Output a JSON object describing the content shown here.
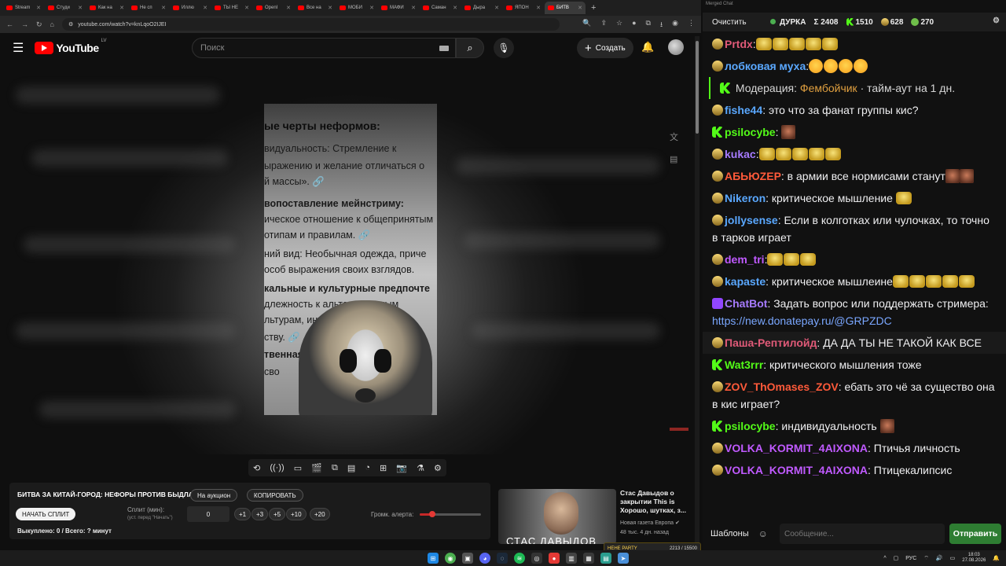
{
  "browser": {
    "tabs": [
      {
        "label": "Stream",
        "active": false
      },
      {
        "label": "Студи",
        "active": false
      },
      {
        "label": "Как на",
        "active": false
      },
      {
        "label": "Не сп",
        "active": false
      },
      {
        "label": "Иллю",
        "active": false
      },
      {
        "label": "ТЫ НЕ",
        "active": false
      },
      {
        "label": "OpenI",
        "active": false
      },
      {
        "label": "Все на",
        "active": false
      },
      {
        "label": "МОБИ",
        "active": false
      },
      {
        "label": "МАФИ",
        "active": false
      },
      {
        "label": "Саман",
        "active": false
      },
      {
        "label": "Дыра",
        "active": false
      },
      {
        "label": "ЯПОН",
        "active": false
      },
      {
        "label": "БИТВ",
        "active": true
      }
    ],
    "url": "youtube.com/watch?v=knLqoO2IJEI"
  },
  "youtube": {
    "logo_text": "YouTube",
    "country": "LV",
    "search_placeholder": "Поиск",
    "create_label": "Создать"
  },
  "video": {
    "card_lines": [
      {
        "text": "ые черты неформов:",
        "style": "h"
      },
      {
        "text": "видуальность: Стремление к",
        "bold_prefix": "видуальность:"
      },
      {
        "text": "ыражению и желание отличаться о"
      },
      {
        "text": "й массы». 🔗"
      },
      {
        "text": "вопоставление мейнстриму:",
        "style": "b"
      },
      {
        "text": "ическое отношение к общепринятым"
      },
      {
        "text": "отипам и правилам. 🔗"
      },
      {
        "text": "ний вид: Необычная одежда, приче",
        "bold_prefix": "ний вид:"
      },
      {
        "text": "особ выражения своих взглядов."
      },
      {
        "text": "кальные и культурные предпочте",
        "style": "b"
      },
      {
        "text": "длежность к альтернативным"
      },
      {
        "text": "льтурам, инте               и"
      },
      {
        "text": "ству. 🔗"
      },
      {
        "text": "твенная",
        "style": "b"
      },
      {
        "text": "сво"
      }
    ]
  },
  "toolbar_icons": [
    "loop-icon",
    "broadcast-icon",
    "screen-icon",
    "clapper-icon",
    "pip-icon",
    "subtitles-icon",
    "speed-icon",
    "add-icon",
    "camera-icon",
    "flask-icon",
    "settings-icon"
  ],
  "panel": {
    "title": "БИТВА ЗА КИТАЙ-ГОРОД: НЕФОРЫ ПРОТИВ БЫДЛА",
    "auction_btn": "На аукцион",
    "copy_btn": "КОПИРОВАТЬ",
    "start_btn": "НАЧАТЬ СПЛИТ",
    "split_label": "Сплит (мин):",
    "split_hint": "(уст. перед \"Начать\")",
    "split_value": "0",
    "increments": [
      "+1",
      "+3",
      "+5",
      "+10",
      "+20"
    ],
    "volume_label": "Громк. алерта:",
    "volume_fraction": 0.21,
    "bought": "Выкуплено: 0 / Всего: ? минут"
  },
  "recommendation": {
    "title": "Стас Давыдов о закрытии This is Хорошо, шутках, з...",
    "channel": "Новая газета Европа",
    "meta": "48 тыс.  4 дн. назад",
    "thumb_caption": "СТАС ДАВЫДОВ"
  },
  "chat": {
    "window_title": "Merged Chat",
    "clear_label": "Очистить",
    "channel": "ДУРКА",
    "stat_total": "Σ 2408",
    "stat_kick": "1510",
    "stat_twitch": "628",
    "stat_vk": "270",
    "templates_label": "Шаблоны",
    "input_placeholder": "Сообщение...",
    "send_label": "Отправить",
    "messages": [
      {
        "badge": "t",
        "nick": "Prtdx",
        "color": "#e05a78",
        "text": "",
        "emotes": "emo5"
      },
      {
        "badge": "t",
        "nick": "лобковая муха",
        "color": "#5aa8ff",
        "text": "",
        "emotes": "laugh4"
      },
      {
        "type": "mod",
        "badge": "k",
        "prefix": "Модерация:",
        "nick": "Фембойчик",
        "color": "#e0a040",
        "text": " · тайм-аут на 1 дн."
      },
      {
        "badge": "t",
        "nick": "fishe44",
        "color": "#5aa8ff",
        "text": " это что за фанат группы кис?"
      },
      {
        "badge": "k",
        "nick": "psilocybe",
        "color": "#53fc18",
        "text": " ",
        "emotes": "face1"
      },
      {
        "badge": "t",
        "nick": "kukac",
        "color": "#a77bff",
        "text": "",
        "emotes": "emo5"
      },
      {
        "badge": "t",
        "nick": "АБЬЮZЕР",
        "color": "#ff5a3a",
        "text": " в армии все нормисами станут",
        "emotes": "face2"
      },
      {
        "badge": "t",
        "nick": "Nikeron",
        "color": "#5aa8ff",
        "text": " критическое мышление ",
        "emotes": "emo1"
      },
      {
        "badge": "t",
        "nick": "jollysense",
        "color": "#5aa8ff",
        "text": " Если в колготках или чулочках, то точно в тарков играет"
      },
      {
        "badge": "t",
        "nick": "dem_tri",
        "color": "#c05aff",
        "text": "",
        "emotes": "emo3"
      },
      {
        "badge": "t",
        "nick": "kapaste",
        "color": "#5aa8ff",
        "text": " критическое мышлеине",
        "emotes": "emo5"
      },
      {
        "badge": "bot",
        "nick": "ChatBot",
        "color": "#a77bff",
        "text": " Задать вопрос или поддержать стримера: ",
        "link": "https://new.donatepay.ru/@GRPZDC"
      },
      {
        "badge": "t",
        "nick": "Паша-Рептилойд",
        "color": "#e05a78",
        "text": " ДА ДА ТЫ НЕ ТАКОЙ КАК ВСЕ",
        "highlight": true
      },
      {
        "badge": "k",
        "nick": "Wat3rrr",
        "color": "#53fc18",
        "text": " критического мышления тоже"
      },
      {
        "badge": "t",
        "nick": "ZOV_ThOmases_ZOV",
        "color": "#ff5a3a",
        "text": " ебать это чё за существо она в кис играет?"
      },
      {
        "badge": "k",
        "nick": "psilocybe",
        "color": "#53fc18",
        "text": " индивидуальность ",
        "emotes": "face1"
      },
      {
        "badge": "t",
        "nick": "VOLKA_KORMIT_4AIXONA",
        "color": "#c05aff",
        "text": " Птичья личность"
      },
      {
        "badge": "t",
        "nick": "VOLKA_KORMIT_4AIXONA",
        "color": "#c05aff",
        "text": " Птицекалипсис"
      }
    ]
  },
  "overlay": {
    "label": "HEHE PARTY",
    "progress": "2213 / 15500"
  },
  "taskbar": {
    "lang": "РУС",
    "time": "18:03",
    "date": "27.08.2026"
  }
}
